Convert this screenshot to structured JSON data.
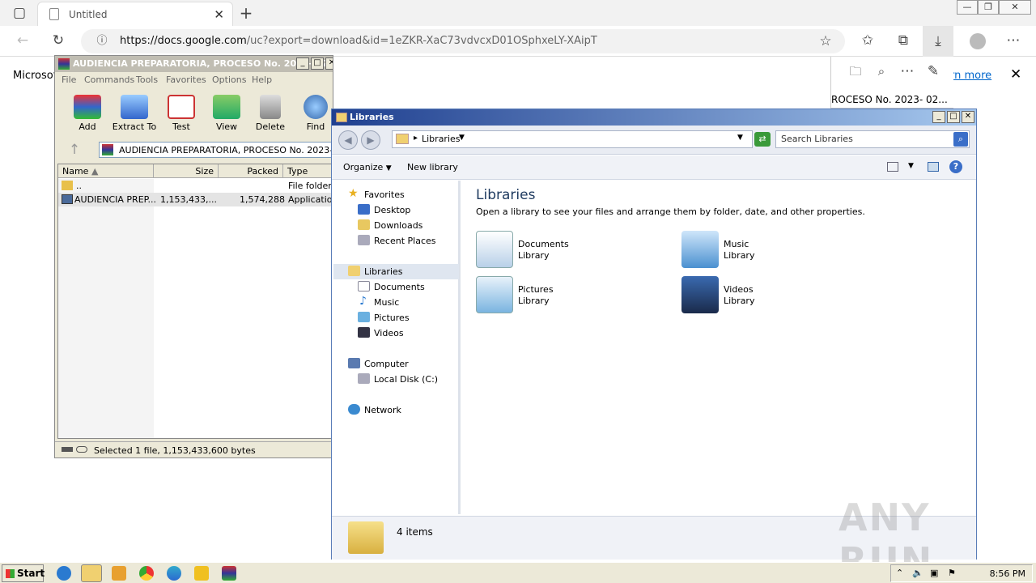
{
  "browser": {
    "tab_title": "Untitled",
    "url_host": "https://docs.google.com",
    "url_path": "/uc?export=download&id=1eZKR-XaC73vdvcxD01OSphxeLY-XAipT",
    "page_text": "Microsof",
    "banner_link": "arn more",
    "download_snippet": "ROCESO No. 2023- 02..."
  },
  "winrar": {
    "title": "AUDIENCIA PREPARATORIA, PROCESO No. 2023- 02191.tar",
    "menu": [
      "File",
      "Commands",
      "Tools",
      "Favorites",
      "Options",
      "Help"
    ],
    "toolbar": [
      "Add",
      "Extract To",
      "Test",
      "View",
      "Delete",
      "Find"
    ],
    "path": "AUDIENCIA PREPARATORIA, PROCESO No. 2023- 021",
    "columns": [
      "Name",
      "Size",
      "Packed",
      "Type"
    ],
    "rows": [
      {
        "name": "..",
        "size": "",
        "packed": "",
        "type": "File folder"
      },
      {
        "name": "AUDIENCIA PREP...",
        "size": "1,153,433,...",
        "packed": "1,574,288",
        "type": "Application"
      }
    ],
    "status": "Selected 1 file, 1,153,433,600 bytes"
  },
  "libraries": {
    "title": "Libraries",
    "address": "Libraries",
    "search_placeholder": "Search Libraries",
    "organize": "Organize",
    "new_library": "New library",
    "nav": {
      "favorites": "Favorites",
      "desktop": "Desktop",
      "downloads": "Downloads",
      "recent": "Recent Places",
      "libraries": "Libraries",
      "documents": "Documents",
      "music": "Music",
      "pictures": "Pictures",
      "videos": "Videos",
      "computer": "Computer",
      "local_disk": "Local Disk (C:)",
      "network": "Network"
    },
    "heading": "Libraries",
    "subheading": "Open a library to see your files and arrange them by folder, date, and other properties.",
    "items": [
      {
        "name": "Documents",
        "kind": "Library"
      },
      {
        "name": "Music",
        "kind": "Library"
      },
      {
        "name": "Pictures",
        "kind": "Library"
      },
      {
        "name": "Videos",
        "kind": "Library"
      }
    ],
    "count": "4 items"
  },
  "taskbar": {
    "start": "Start",
    "clock": "8:56 PM"
  },
  "watermark": "ANY RUN"
}
